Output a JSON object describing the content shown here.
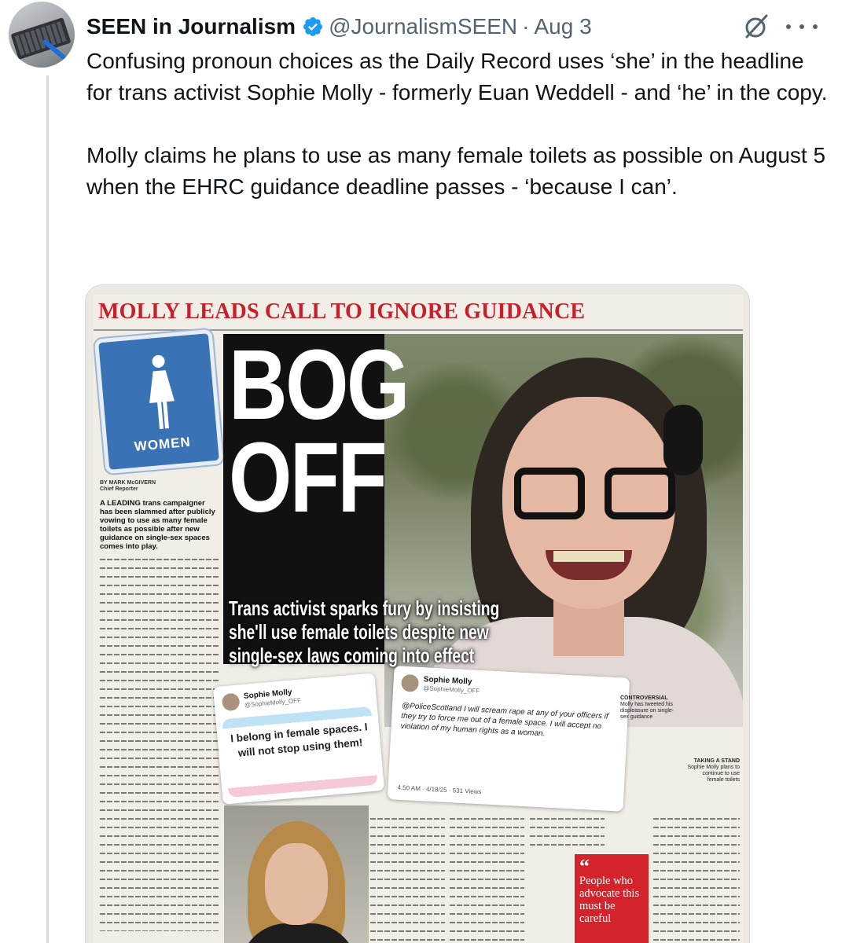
{
  "tweet": {
    "author_name": "SEEN in Journalism",
    "handle": "@JournalismSEEN",
    "separator": "·",
    "date": "Aug 3",
    "paragraphs": [
      "Confusing pronoun choices as the Daily Record uses ‘she’ in the headline for trans activist Sophie Molly - formerly Euan Weddell - and ‘he’ in the copy.",
      "Molly claims he plans to use as many female toilets as possible on August 5 when the EHRC guidance deadline passes - ‘because I can’."
    ],
    "icons": {
      "verified": "verified-badge-icon",
      "grok": "grok-icon",
      "more": "more-options-icon"
    },
    "colors": {
      "text": "#0f1419",
      "secondary": "#536471",
      "verified": "#1d9bf0",
      "border": "#cfd9de"
    }
  },
  "article": {
    "kicker": "MOLLY LEADS CALL TO IGNORE GUIDANCE",
    "headline_line1": "BOG",
    "headline_line2": "OFF",
    "subhead_line1": "Trans activist sparks fury by insisting",
    "subhead_line2": "she'll use female toilets despite new",
    "subhead_line3": "single-sex laws coming into effect",
    "sign_label": "WOMEN",
    "byline_name": "BY MARK McGIVERN",
    "byline_role": "Chief Reporter",
    "lede": "A LEADING trans campaigner has been slammed after publicly vowing to use as many female toilets as possible after new guidance on single-sex spaces comes into play.",
    "card1": {
      "name": "Sophie Molly",
      "handle": "@SophieMolly_OFF",
      "quote": "I belong in female spaces. I will not stop using them!"
    },
    "card2": {
      "name": "Sophie Molly",
      "handle": "@SophieMolly_OFF",
      "text": "@PoliceScotland I will scream rape at any of your officers if they try to force me out of a female space. I will accept no violation of my human rights as a woman.",
      "meta": "4:50 AM · 4/18/25 · 531 Views"
    },
    "controversial_title": "CONTROVERSIAL",
    "controversial_text": "Molly has tweeted his displeasure on single-sex guidance",
    "taking_title": "TAKING A STAND",
    "taking_text": "Sophie Molly plans to continue to use female toilets",
    "pullquote": "People who advocate this must be careful",
    "colors": {
      "kicker": "#c8202a",
      "sign": "#3a72b6",
      "pullquote": "#d4232b"
    }
  }
}
